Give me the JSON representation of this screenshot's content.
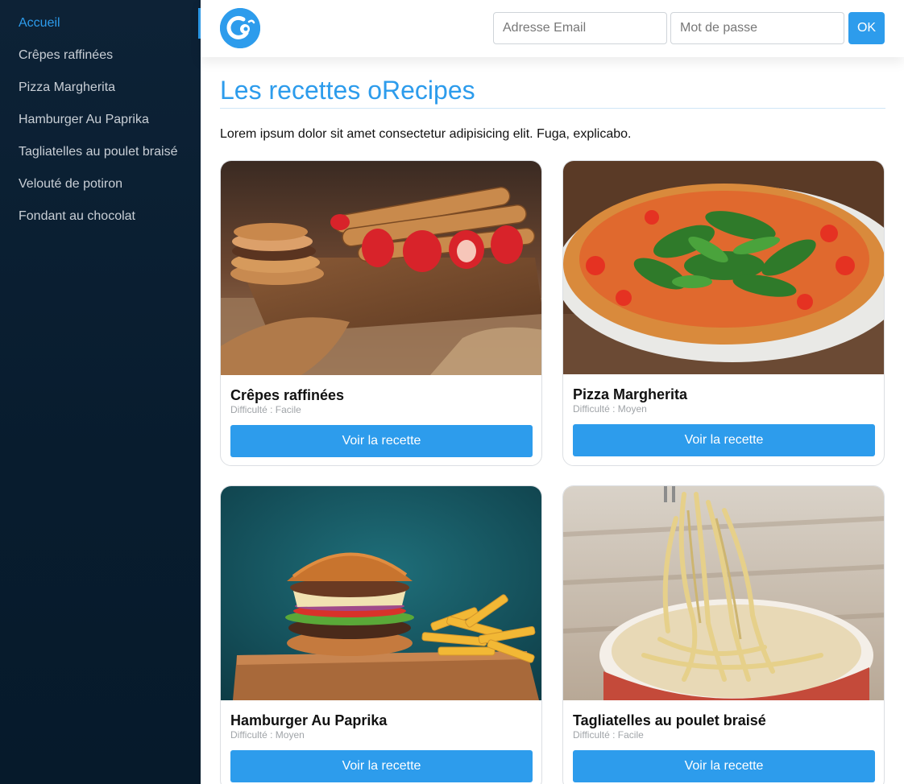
{
  "sidebar": {
    "items": [
      {
        "label": "Accueil",
        "active": true
      },
      {
        "label": "Crêpes raffinées"
      },
      {
        "label": "Pizza Margherita"
      },
      {
        "label": "Hamburger Au Paprika"
      },
      {
        "label": "Tagliatelles au poulet braisé"
      },
      {
        "label": "Velouté de potiron"
      },
      {
        "label": "Fondant au chocolat"
      }
    ]
  },
  "header": {
    "logo_icon": "orecipes-logo-icon",
    "email_placeholder": "Adresse Email",
    "password_placeholder": "Mot de passe",
    "submit_label": "OK"
  },
  "main": {
    "title": "Les recettes oRecipes",
    "intro": "Lorem ipsum dolor sit amet consectetur adipisicing elit. Fuga, explicabo."
  },
  "recipes": [
    {
      "title": "Crêpes raffinées",
      "difficulty": "Difficulté : Facile",
      "button": "Voir la recette",
      "image": "crepes-photo"
    },
    {
      "title": "Pizza Margherita",
      "difficulty": "Difficulté : Moyen",
      "button": "Voir la recette",
      "image": "pizza-photo"
    },
    {
      "title": "Hamburger Au Paprika",
      "difficulty": "Difficulté : Moyen",
      "button": "Voir la recette",
      "image": "burger-photo"
    },
    {
      "title": "Tagliatelles au poulet braisé",
      "difficulty": "Difficulté : Facile",
      "button": "Voir la recette",
      "image": "pasta-photo"
    }
  ],
  "colors": {
    "accent": "#2d9cec",
    "sidebar_bg": "#081c2e",
    "sidebar_text": "#c9cfd6"
  }
}
